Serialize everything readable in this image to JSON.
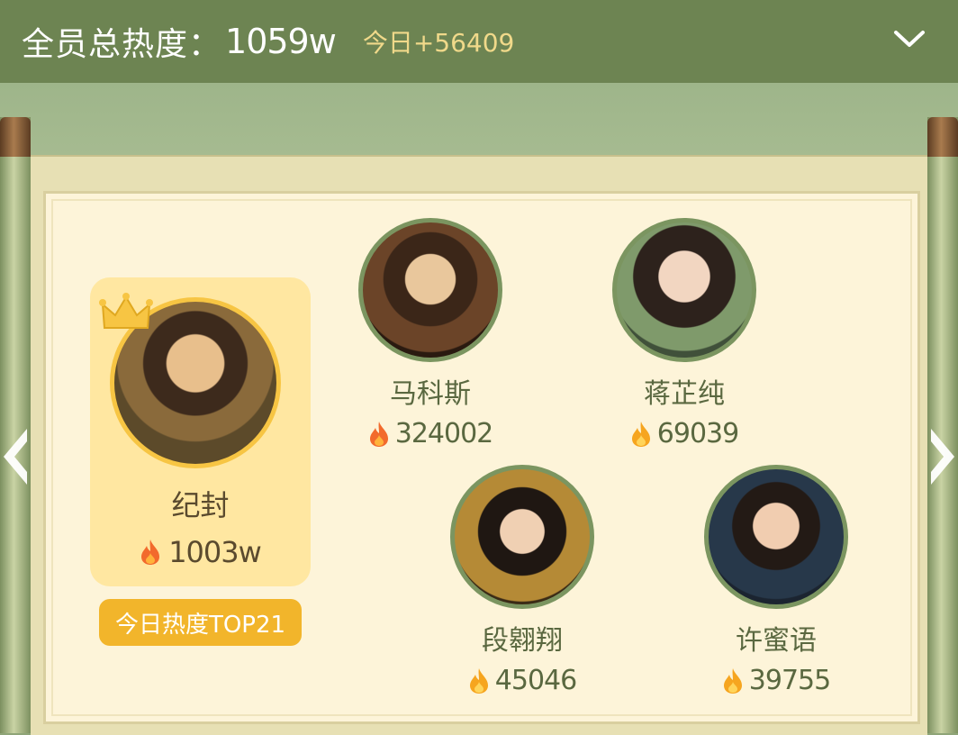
{
  "header": {
    "total_label": "全员总热度：",
    "total_value": "1059w",
    "today_delta": "今日+56409",
    "expand_icon": "chevron-down-icon"
  },
  "top_member": {
    "name": "纪封",
    "heat": "1003w",
    "badge": "今日热度TOP21",
    "crown_icon": "crown-icon",
    "flame_icon": "flame-icon"
  },
  "members": [
    {
      "name": "马科斯",
      "heat": "324002"
    },
    {
      "name": "蒋芷纯",
      "heat": "69039"
    },
    {
      "name": "段翱翔",
      "heat": "45046"
    },
    {
      "name": "许蜜语",
      "heat": "39755"
    }
  ],
  "nav": {
    "prev_icon": "chevron-left-icon",
    "next_icon": "chevron-right-icon"
  },
  "colors": {
    "header_bg": "#6d8452",
    "accent_gold": "#f2b52b",
    "highlight_text": "#f0d98a",
    "name_text": "#5a6840"
  }
}
